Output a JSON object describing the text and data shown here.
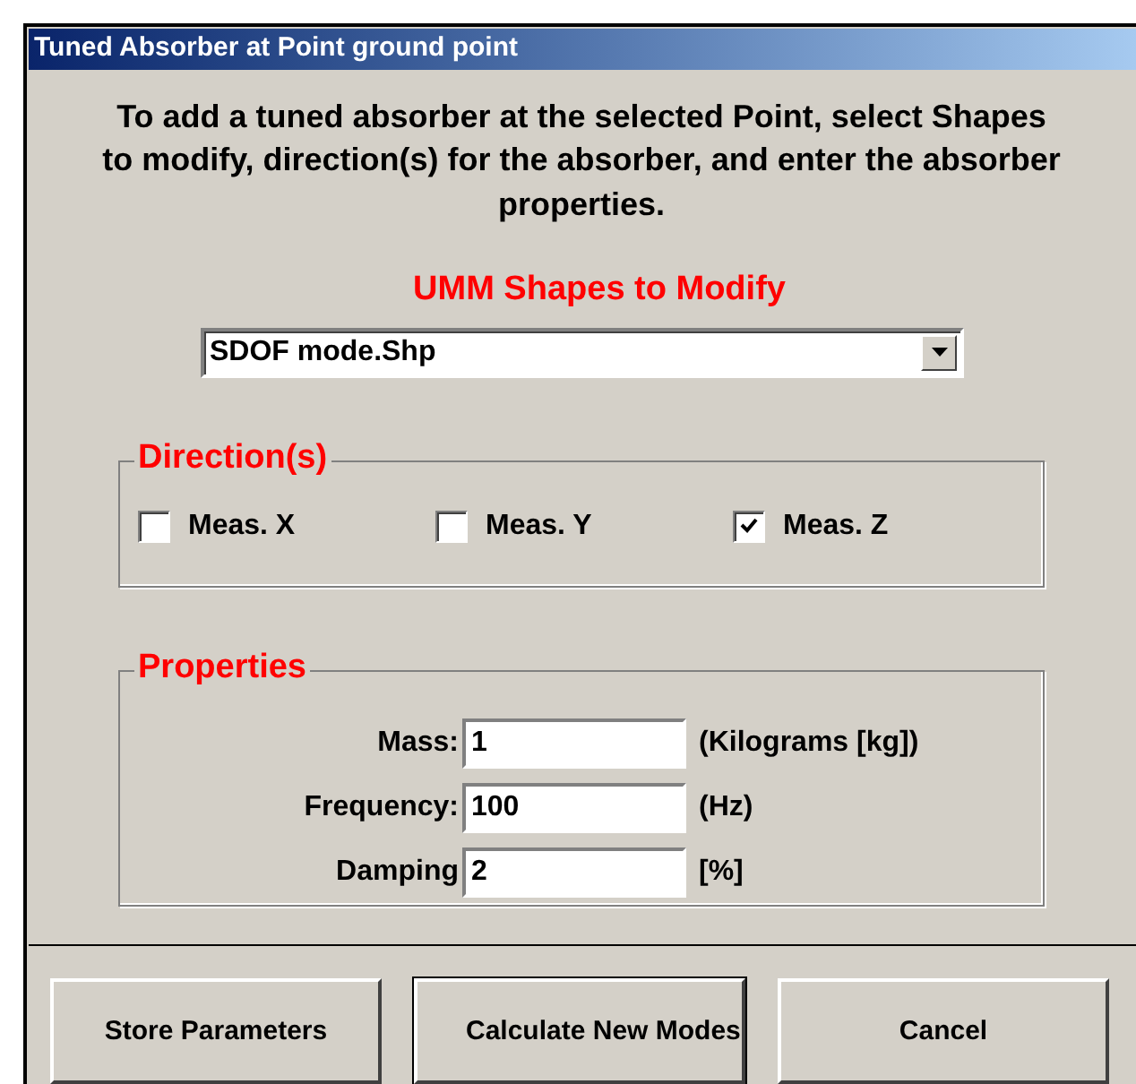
{
  "window": {
    "title": "Tuned Absorber at Point ground point"
  },
  "instructions": "To add a tuned absorber at the selected Point, select Shapes to modify, direction(s) for the absorber, and enter the absorber properties.",
  "shapes": {
    "label": "UMM Shapes to Modify",
    "value": "SDOF mode.Shp"
  },
  "directions": {
    "title": "Direction(s)",
    "items": [
      {
        "label": "Meas. X",
        "checked": false
      },
      {
        "label": "Meas. Y",
        "checked": false
      },
      {
        "label": "Meas. Z",
        "checked": true
      }
    ]
  },
  "properties": {
    "title": "Properties",
    "fields": [
      {
        "label": "Mass:",
        "value": "1",
        "unit": "(Kilograms [kg])"
      },
      {
        "label": "Frequency:",
        "value": "100",
        "unit": "(Hz)"
      },
      {
        "label": "Damping",
        "value": "2",
        "unit": "[%]"
      }
    ]
  },
  "buttons": [
    {
      "label": "Store Parameters",
      "default": false
    },
    {
      "label": "Calculate New Modes",
      "default": true
    },
    {
      "label": "Cancel",
      "default": false
    }
  ]
}
